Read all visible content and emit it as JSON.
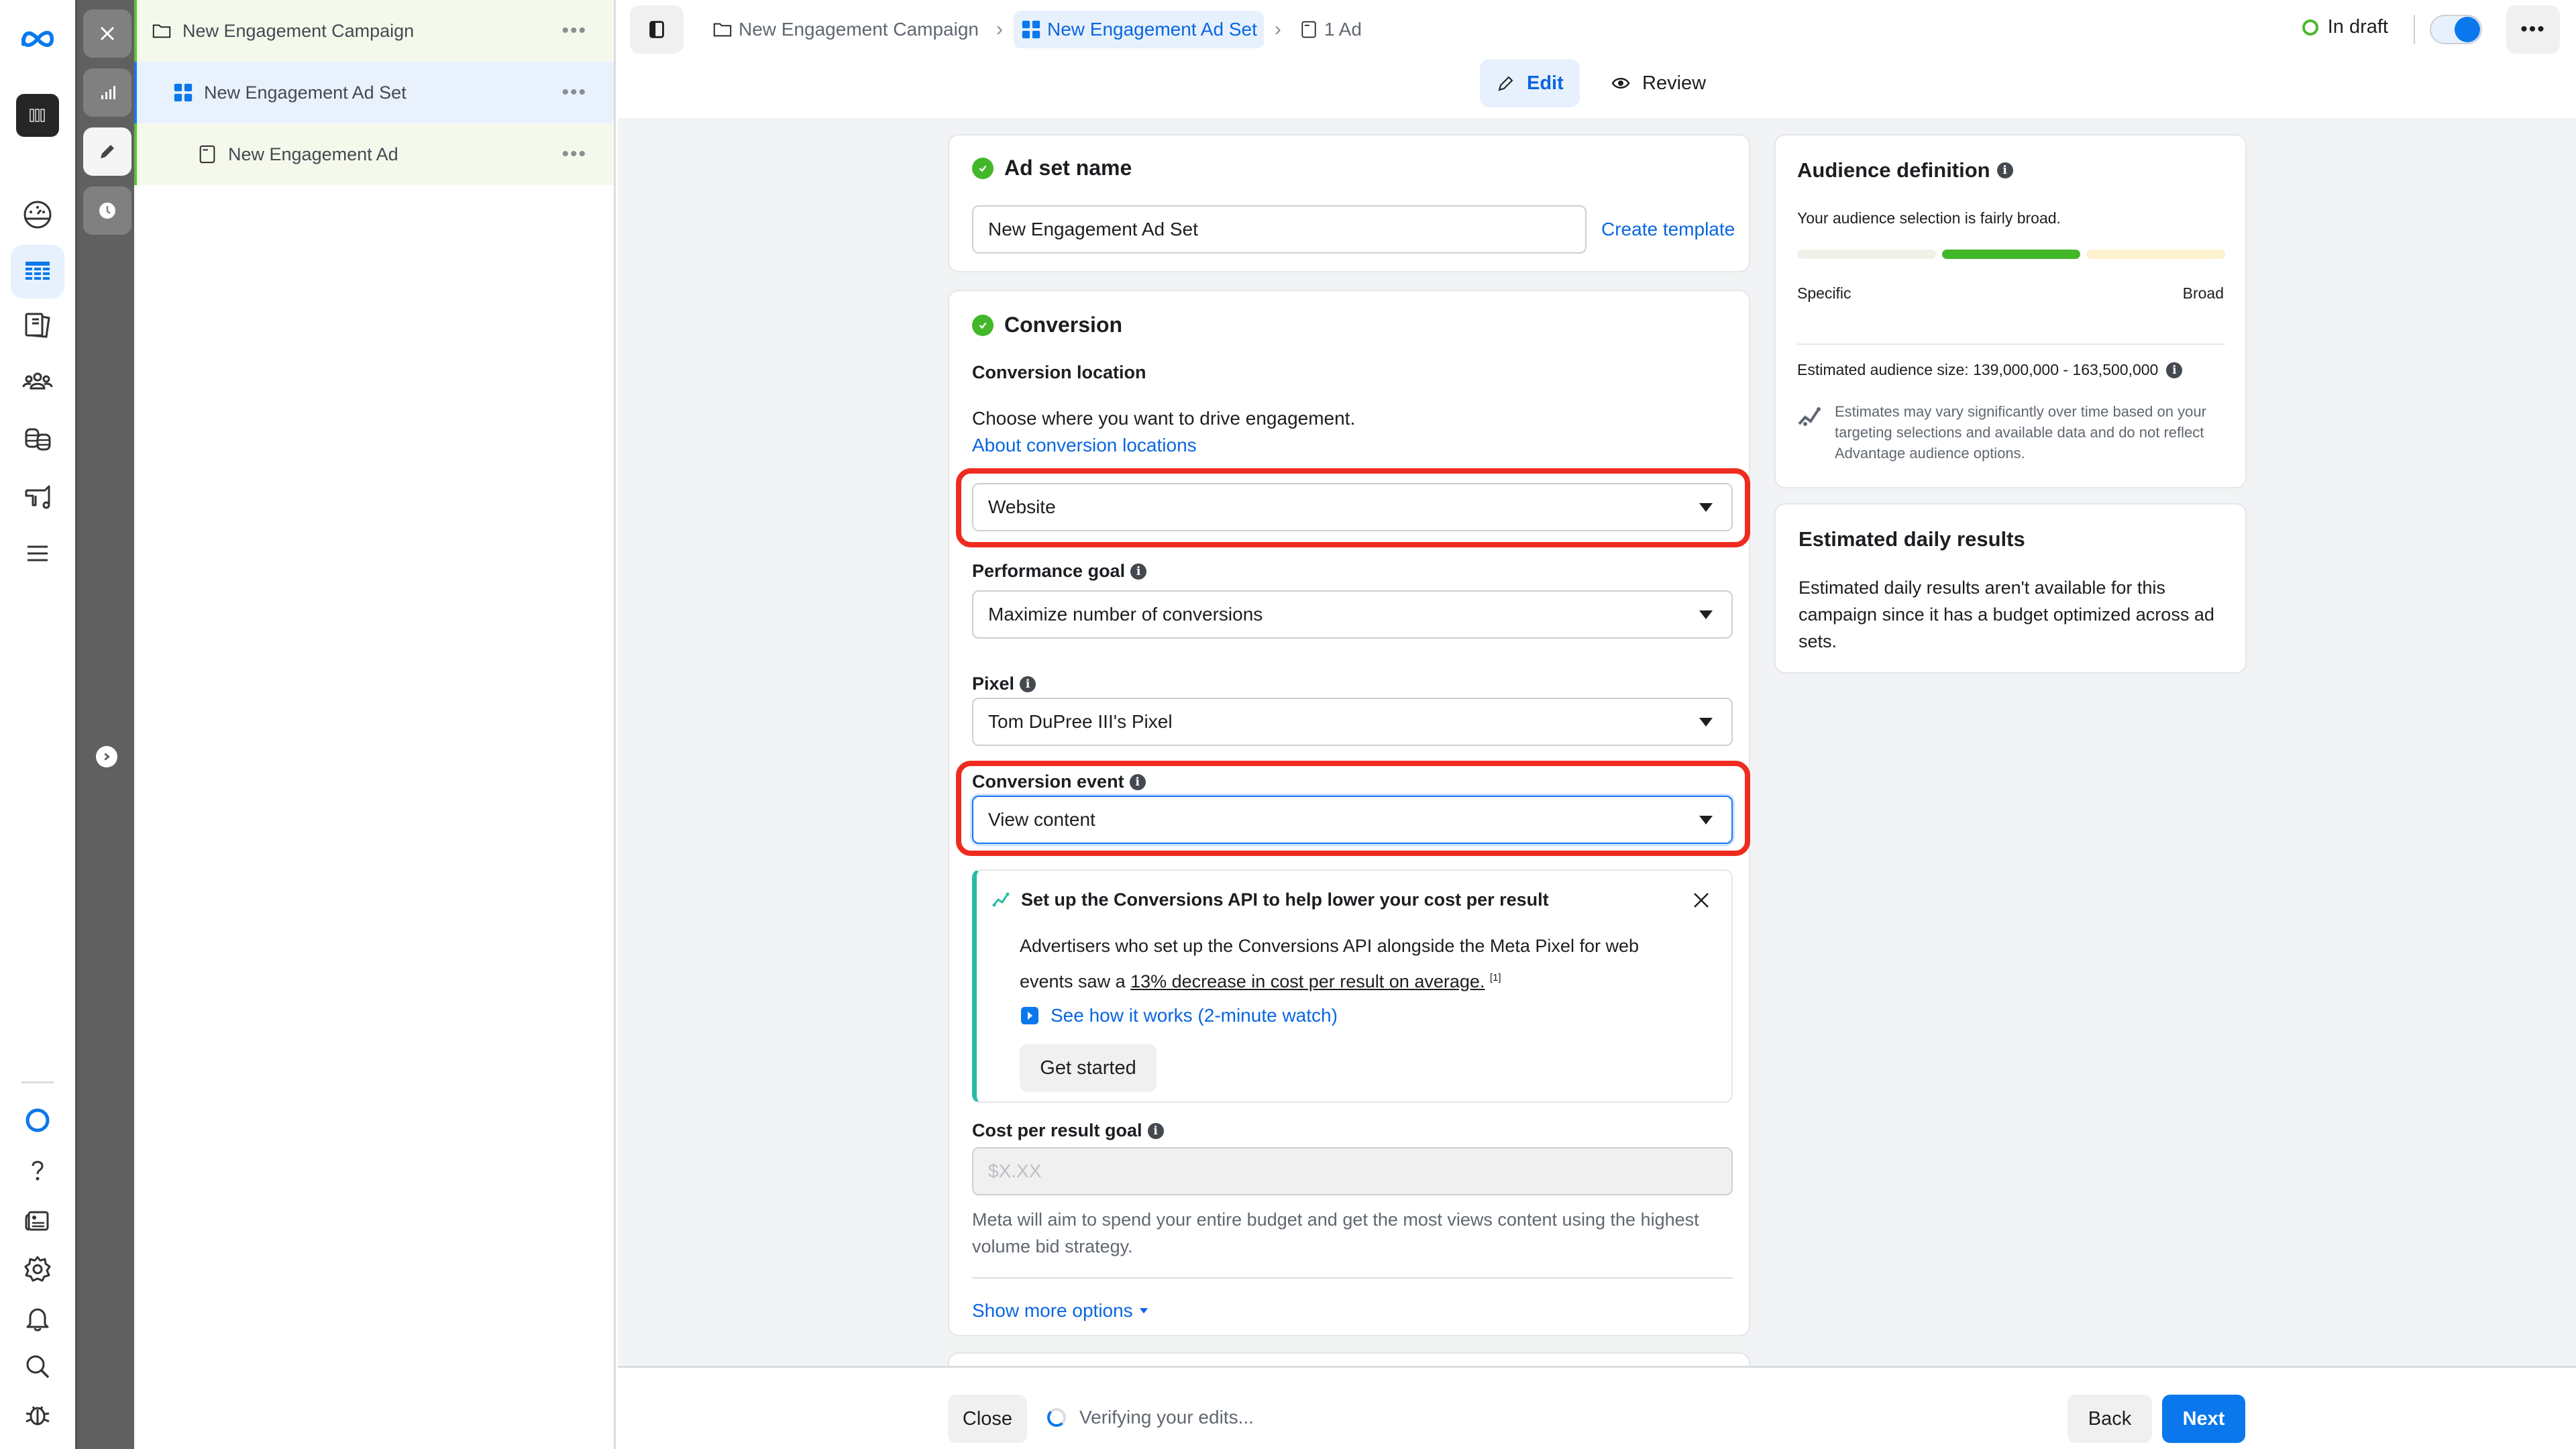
{
  "app": {
    "logo": "meta-logo"
  },
  "rail": {
    "top_icons": [
      "meta-logo",
      "account-avatar",
      "dashboard-gauge",
      "ads-manager-table",
      "catalog-pages",
      "audiences-people",
      "billing-coins",
      "campaign-megaphone",
      "menu"
    ],
    "bottom_icons": [
      "meta-ai-ring",
      "help",
      "news",
      "settings",
      "notifications-bell",
      "search",
      "bug-report"
    ]
  },
  "tools": {
    "buttons": [
      "close",
      "charts",
      "edit",
      "history"
    ]
  },
  "tree": {
    "items": [
      {
        "label": "New Engagement Campaign",
        "type": "campaign",
        "more": "•••"
      },
      {
        "label": "New Engagement Ad Set",
        "type": "adset",
        "more": "•••"
      },
      {
        "label": "New Engagement Ad",
        "type": "ad",
        "more": "•••"
      }
    ]
  },
  "topbar": {
    "breadcrumbs": [
      {
        "label": "New Engagement Campaign",
        "icon": "folder"
      },
      {
        "label": "New Engagement Ad Set",
        "icon": "grid"
      },
      {
        "label": "1 Ad",
        "icon": "ad-page"
      }
    ],
    "status": "In draft",
    "toggle_on": true,
    "more": "•••"
  },
  "modes": {
    "edit": "Edit",
    "review": "Review"
  },
  "adset_name": {
    "title": "Ad set name",
    "value": "New Engagement Ad Set",
    "create_template": "Create template"
  },
  "conversion": {
    "title": "Conversion",
    "location_label": "Conversion location",
    "location_help": "Choose where you want to drive engagement.",
    "location_link": "About conversion locations",
    "location_value": "Website",
    "performance_goal_label": "Performance goal",
    "performance_goal_value": "Maximize number of conversions",
    "pixel_label": "Pixel",
    "pixel_value": "Tom DuPree III's Pixel",
    "event_label": "Conversion event",
    "event_value": "View content",
    "capi_banner": {
      "title": "Set up the Conversions API to help lower your cost per result",
      "body_1": "Advertisers who set up the Conversions API alongside the Meta Pixel for web events saw a ",
      "body_link": "13% decrease in cost per result on average.",
      "footnote": "[1]",
      "video_link": "See how it works (2-minute watch)",
      "cta": "Get started"
    },
    "cost_goal_label": "Cost per result goal",
    "cost_goal_placeholder": "$X.XX",
    "cost_goal_help": "Meta will aim to spend your entire budget and get the most views content using the highest volume bid strategy.",
    "show_more": "Show more options"
  },
  "audience": {
    "title": "Audience definition",
    "summary": "Your audience selection is fairly broad.",
    "meter_level": "middle of 3 segments (fairly broad)",
    "left_label": "Specific",
    "right_label": "Broad",
    "size_text": "Estimated audience size: 139,000,000 - 163,500,000",
    "disclaimer": "Estimates may vary significantly over time based on your targeting selections and available data and do not reflect Advantage audience options."
  },
  "daily_results": {
    "title": "Estimated daily results",
    "body": "Estimated daily results aren't available for this campaign since it has a budget optimized across ad sets."
  },
  "footer": {
    "close": "Close",
    "status": "Verifying your edits...",
    "back": "Back",
    "next": "Next"
  },
  "colors": {
    "accent": "#0a78ec",
    "success": "#42b72a",
    "highlight": "#ef2b1f",
    "capi_bar": "#2abba7"
  }
}
